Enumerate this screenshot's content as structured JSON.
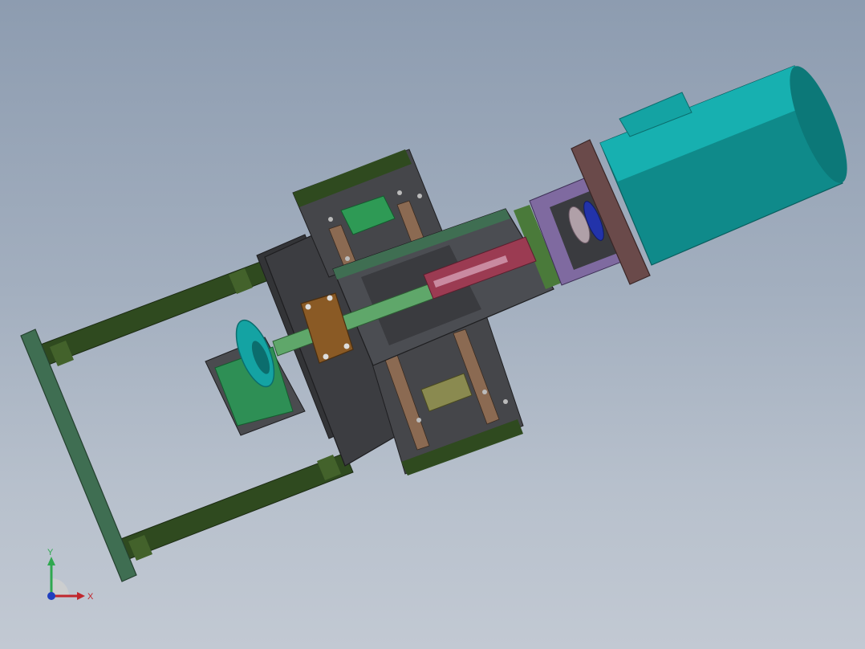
{
  "viewport": {
    "background_top": "#8d9cb0",
    "background_bottom": "#c2c9d3"
  },
  "colors": {
    "motor_teal": "#14a3a3",
    "motor_dark": "#0b6d6d",
    "plate_dark": "#3c3d41",
    "rail_green": "#2f4a1f",
    "frame_green": "#3f6e52",
    "bearing_green": "#2e9a55",
    "shaft_green": "#5fa76a",
    "nut_brown": "#8a5a25",
    "accent_purple": "#8a6fa8",
    "accent_red": "#9b3b52",
    "accent_blue": "#2233aa",
    "axis_x": "#c0272d",
    "axis_y": "#2fa84f",
    "axis_z": "#1f3fbf"
  },
  "triad": {
    "x_label": "X",
    "y_label": "Y"
  }
}
